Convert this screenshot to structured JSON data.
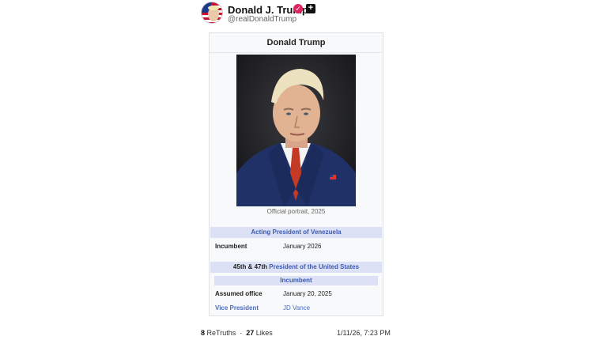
{
  "post": {
    "display_name": "Donald J. Trump",
    "handle": "@realDonaldTrump",
    "retruths_count": "8",
    "retruths_label": "ReTruths",
    "likes_count": "27",
    "likes_label": "Likes",
    "timestamp": "1/11/26, 7:23 PM"
  },
  "infobox": {
    "title": "Donald Trump",
    "portrait_caption": "Official portrait, 2025",
    "section1": {
      "prefix": "Acting ",
      "link": "President of Venezuela",
      "row_label": "Incumbent",
      "row_value": "January 2026"
    },
    "section2": {
      "prefix": "45th & 47th ",
      "link": "President of the United States",
      "subhead": "Incumbent",
      "assumed_label": "Assumed office",
      "assumed_value": "January 20, 2025",
      "vp_label": "Vice President",
      "vp_value": "JD Vance"
    }
  },
  "colors": {
    "section_bg": "#dde1f5",
    "link": "#3e5bb0",
    "verified": "#e0245e"
  },
  "icons": {
    "verified": "verified-check-icon",
    "plus": "plus-badge-icon"
  }
}
